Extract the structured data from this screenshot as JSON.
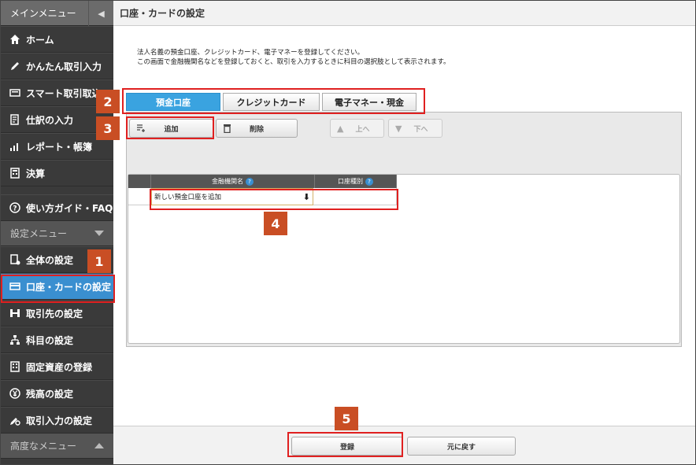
{
  "sidebar": {
    "main_menu_label": "メインメニュー",
    "items": [
      {
        "label": "ホーム",
        "icon": "home-icon"
      },
      {
        "label": "かんたん取引入力",
        "icon": "pencil-icon"
      },
      {
        "label": "スマート取引取込",
        "icon": "import-icon"
      },
      {
        "label": "仕訳の入力",
        "icon": "journal-icon"
      },
      {
        "label": "レポート・帳簿",
        "icon": "chart-icon"
      },
      {
        "label": "決算",
        "icon": "calculator-icon"
      }
    ],
    "guide_label": "使い方ガイド・FAQ",
    "settings_menu_label": "設定メニュー",
    "settings_items": [
      {
        "label": "全体の設定",
        "icon": "settings-doc-icon"
      },
      {
        "label": "口座・カードの設定",
        "icon": "card-icon"
      },
      {
        "label": "取引先の設定",
        "icon": "partner-icon"
      },
      {
        "label": "科目の設定",
        "icon": "tree-icon"
      },
      {
        "label": "固定資産の登録",
        "icon": "building-icon"
      },
      {
        "label": "残高の設定",
        "icon": "yen-icon"
      },
      {
        "label": "取引入力の設定",
        "icon": "gear-pen-icon"
      }
    ],
    "advanced_menu_label": "高度なメニュー"
  },
  "header": {
    "title": "口座・カードの設定"
  },
  "description": {
    "line1": "法人名義の預金口座、クレジットカード、電子マネーを登録してください。",
    "line2": "この画面で金融機関名などを登録しておくと、取引を入力するときに科目の選択肢として表示されます。"
  },
  "tabs": [
    {
      "label": "預金口座",
      "active": true
    },
    {
      "label": "クレジットカード",
      "active": false
    },
    {
      "label": "電子マネー・現金",
      "active": false
    }
  ],
  "toolbar": {
    "add_label": "追加",
    "delete_label": "削除",
    "up_label": "上へ",
    "down_label": "下へ"
  },
  "table": {
    "columns": [
      "金融機関名",
      "口座種別"
    ],
    "input_value": "新しい預金口座を追加"
  },
  "footer": {
    "register_label": "登録",
    "revert_label": "元に戻す"
  },
  "annotations": [
    "1",
    "2",
    "3",
    "4",
    "5"
  ],
  "colors": {
    "active_blue": "#3aa3e0",
    "annotation_red": "#e02020",
    "badge_orange": "#c94e24"
  }
}
